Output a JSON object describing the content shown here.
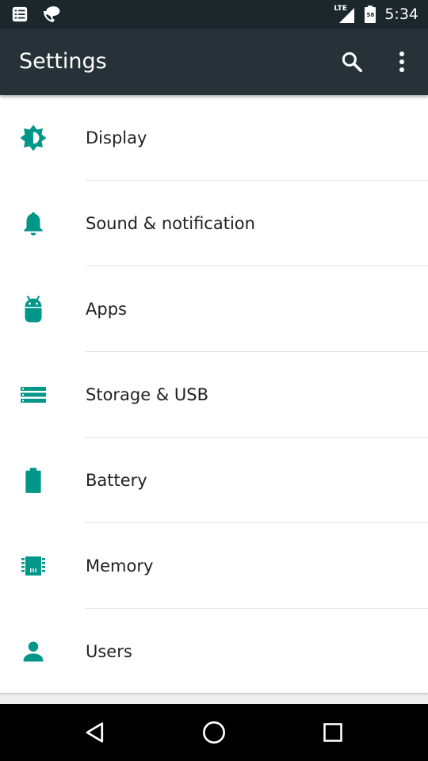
{
  "status_bar": {
    "time": "5:34",
    "network_type": "LTE",
    "battery_level": "58",
    "icons": [
      "notification-list-icon",
      "wifi-calling-icon",
      "signal-icon",
      "battery-icon"
    ]
  },
  "app_bar": {
    "title": "Settings",
    "actions": [
      "search-icon",
      "more-vert-icon"
    ]
  },
  "settings": {
    "items": [
      {
        "label": "Display",
        "icon": "brightness-icon"
      },
      {
        "label": "Sound & notification",
        "icon": "bell-icon"
      },
      {
        "label": "Apps",
        "icon": "android-icon"
      },
      {
        "label": "Storage & USB",
        "icon": "storage-icon"
      },
      {
        "label": "Battery",
        "icon": "battery-icon"
      },
      {
        "label": "Memory",
        "icon": "memory-chip-icon"
      },
      {
        "label": "Users",
        "icon": "person-icon"
      }
    ]
  },
  "nav_bar": {
    "buttons": [
      "back-icon",
      "home-icon",
      "recents-icon"
    ]
  },
  "colors": {
    "status_bar_bg": "#1c272b",
    "app_bar_bg": "#263238",
    "accent": "#009688",
    "list_bg": "#ffffff",
    "text_primary": "#212121",
    "nav_bar_bg": "#000000"
  }
}
